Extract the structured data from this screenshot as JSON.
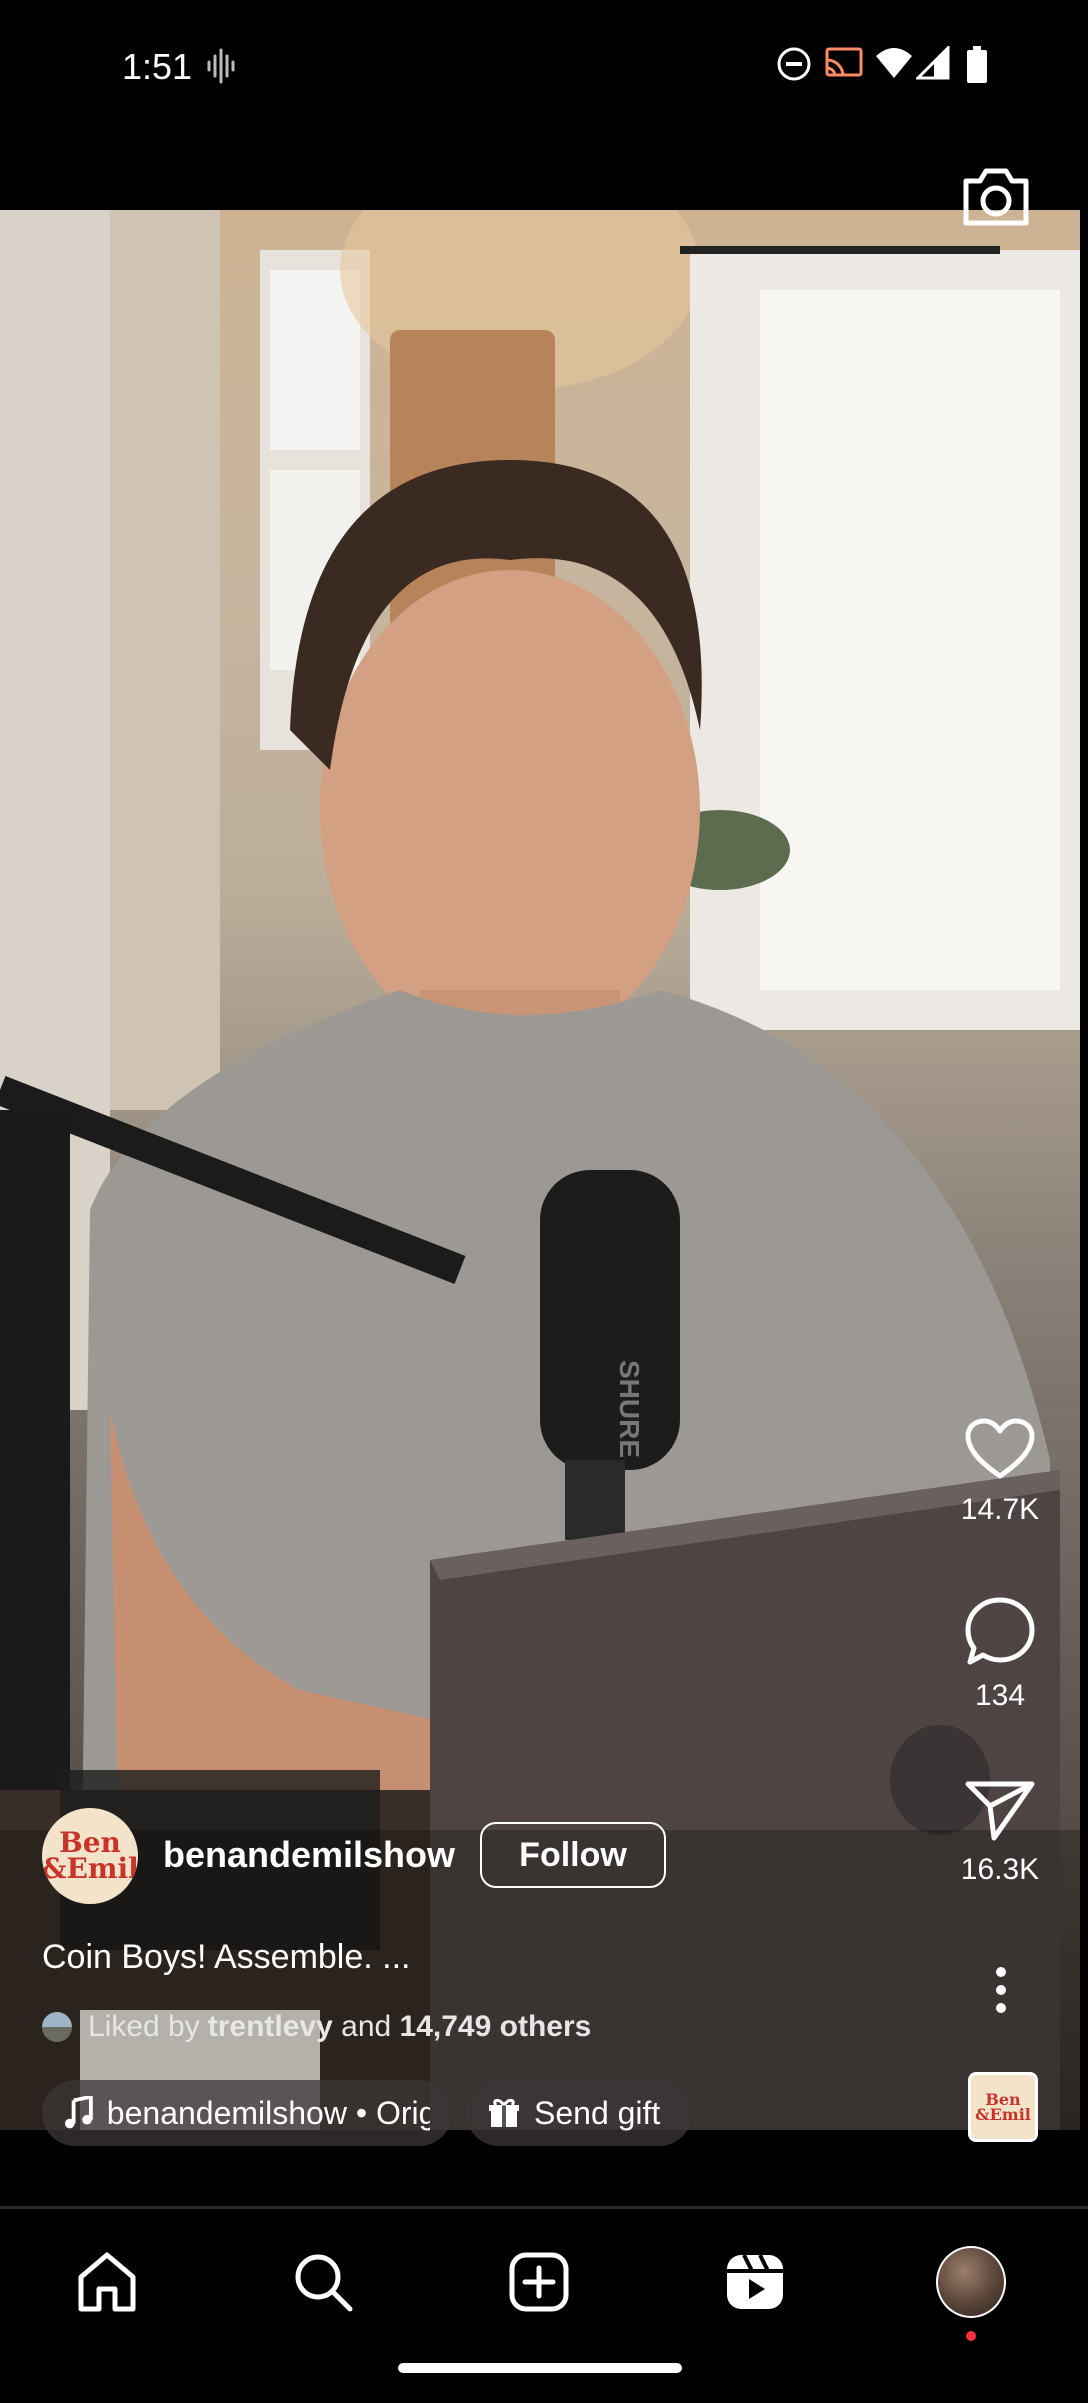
{
  "status_bar": {
    "time": "1:51",
    "icons": [
      "voice-recorder-icon",
      "do-not-disturb-icon",
      "cast-icon",
      "wifi-icon",
      "signal-icon",
      "battery-icon"
    ]
  },
  "reel": {
    "username": "benandemilshow",
    "avatar_text_line1": "Ben",
    "avatar_text_line2": "&Emil",
    "follow_label": "Follow",
    "caption": "Coin Boys! Assemble. ...",
    "liked_prefix": "Liked by ",
    "liked_user": "trentlevy",
    "liked_middle": " and ",
    "liked_others": "14,749 others",
    "audio_label": "benandemilshow • Origi",
    "send_gift_label": "Send gift"
  },
  "actions": {
    "likes": "14.7K",
    "comments": "134",
    "shares": "16.3K"
  },
  "nav": {
    "items": [
      "home-icon",
      "search-icon",
      "create-icon",
      "reels-icon",
      "profile-avatar"
    ]
  },
  "colors": {
    "background": "#000000",
    "brand_red": "#c8332a",
    "notification_dot": "#ff3040"
  }
}
